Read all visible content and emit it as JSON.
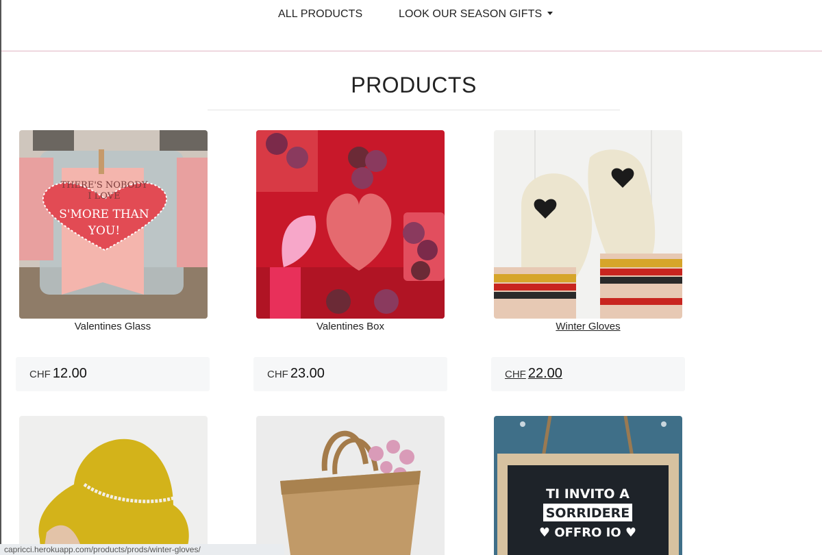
{
  "nav": {
    "all_products": "ALL PRODUCTS",
    "season_gifts": "LOOK OUR SEASON GIFTS"
  },
  "page_title": "PRODUCTS",
  "products": [
    {
      "name": "Valentines Glass",
      "currency": "CHF",
      "price": "12.00",
      "image_text_1": "THERE'S NOBODY",
      "image_text_2": "I LOVE",
      "image_text_3": "S'MORE THAN",
      "image_text_4": "YOU!"
    },
    {
      "name": "Valentines Box",
      "currency": "CHF",
      "price": "23.00"
    },
    {
      "name": "Winter Gloves",
      "currency": "CHF",
      "price": "22.00"
    },
    {
      "name": "",
      "currency": "",
      "price": ""
    },
    {
      "name": "",
      "currency": "",
      "price": ""
    },
    {
      "name": "",
      "currency": "",
      "price": "",
      "image_text_1": "TI INVITO A",
      "image_text_2": "SORRIDERE",
      "image_text_3": "♥ OFFRO IO ♥"
    }
  ],
  "status_bar": "capricci.herokuapp.com/products/prods/winter-gloves/",
  "colors": {
    "nav_border": "#e0b4c2",
    "price_box_bg": "#f6f7f8",
    "text": "#222222"
  }
}
